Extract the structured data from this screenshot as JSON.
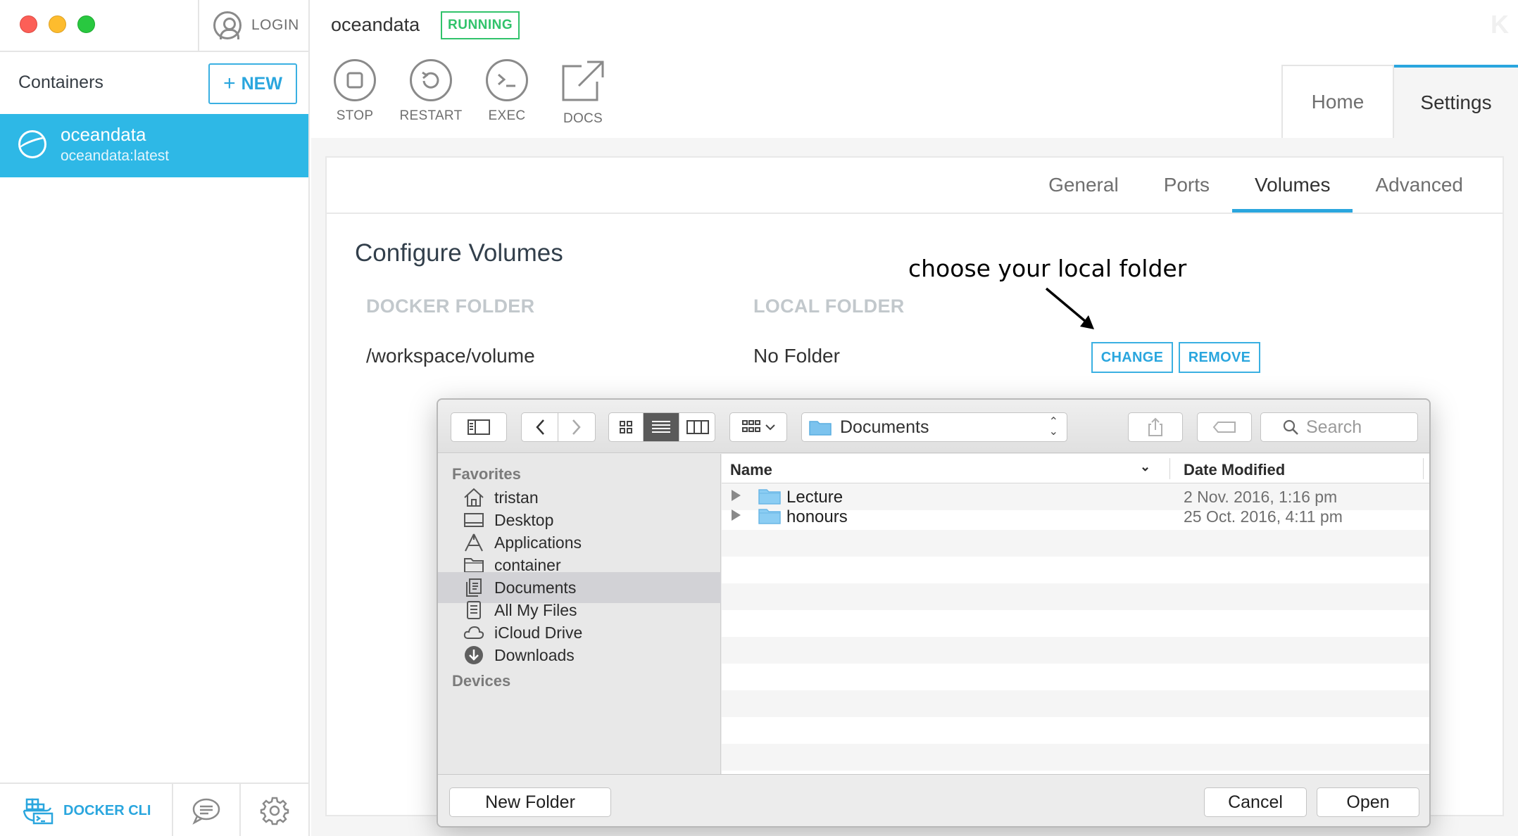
{
  "window": {
    "login_label": "LOGIN",
    "logo_text": "K"
  },
  "sidebar": {
    "containers_label": "Containers",
    "new_button_label": "NEW",
    "container": {
      "name": "oceandata",
      "image": "oceandata:latest",
      "icon": "container-icon"
    },
    "footer": {
      "docker_cli_label": "DOCKER CLI",
      "feedback_icon": "chat-icon",
      "settings_icon": "gear-icon"
    }
  },
  "header": {
    "container_name": "oceandata",
    "status": "RUNNING",
    "actions": [
      {
        "label": "STOP",
        "icon": "stop-icon"
      },
      {
        "label": "RESTART",
        "icon": "restart-icon"
      },
      {
        "label": "EXEC",
        "icon": "terminal-icon"
      },
      {
        "label": "DOCS",
        "icon": "external-link-icon"
      }
    ],
    "tabs": [
      "Home",
      "Settings"
    ],
    "active_tab": "Settings"
  },
  "settings": {
    "subtabs": [
      "General",
      "Ports",
      "Volumes",
      "Advanced"
    ],
    "active_subtab": "Volumes",
    "title": "Configure Volumes",
    "docker_folder_header": "DOCKER FOLDER",
    "local_folder_header": "LOCAL FOLDER",
    "volume": {
      "docker_folder": "/workspace/volume",
      "local_folder": "No Folder",
      "change_label": "CHANGE",
      "remove_label": "REMOVE"
    },
    "annotation": "choose your local folder"
  },
  "dialog": {
    "location": "Documents",
    "search_placeholder": "Search",
    "favorites_header": "Favorites",
    "devices_header": "Devices",
    "favorites": [
      {
        "label": "tristan",
        "icon": "home-icon"
      },
      {
        "label": "Desktop",
        "icon": "desktop-icon"
      },
      {
        "label": "Applications",
        "icon": "applications-icon"
      },
      {
        "label": "container",
        "icon": "folder-icon"
      },
      {
        "label": "Documents",
        "icon": "documents-icon"
      },
      {
        "label": "All My Files",
        "icon": "all-files-icon"
      },
      {
        "label": "iCloud Drive",
        "icon": "cloud-icon"
      },
      {
        "label": "Downloads",
        "icon": "downloads-icon"
      }
    ],
    "selected_favorite": "Documents",
    "columns": {
      "name": "Name",
      "date": "Date Modified"
    },
    "files": [
      {
        "name": "Lecture",
        "date": "2 Nov. 2016, 1:16 pm"
      },
      {
        "name": "honours",
        "date": "25 Oct. 2016, 4:11 pm"
      }
    ],
    "new_folder_label": "New Folder",
    "cancel_label": "Cancel",
    "open_label": "Open"
  },
  "colors": {
    "accent": "#2aa6de",
    "selected_container": "#2eb8e6",
    "running": "#31c36b"
  }
}
